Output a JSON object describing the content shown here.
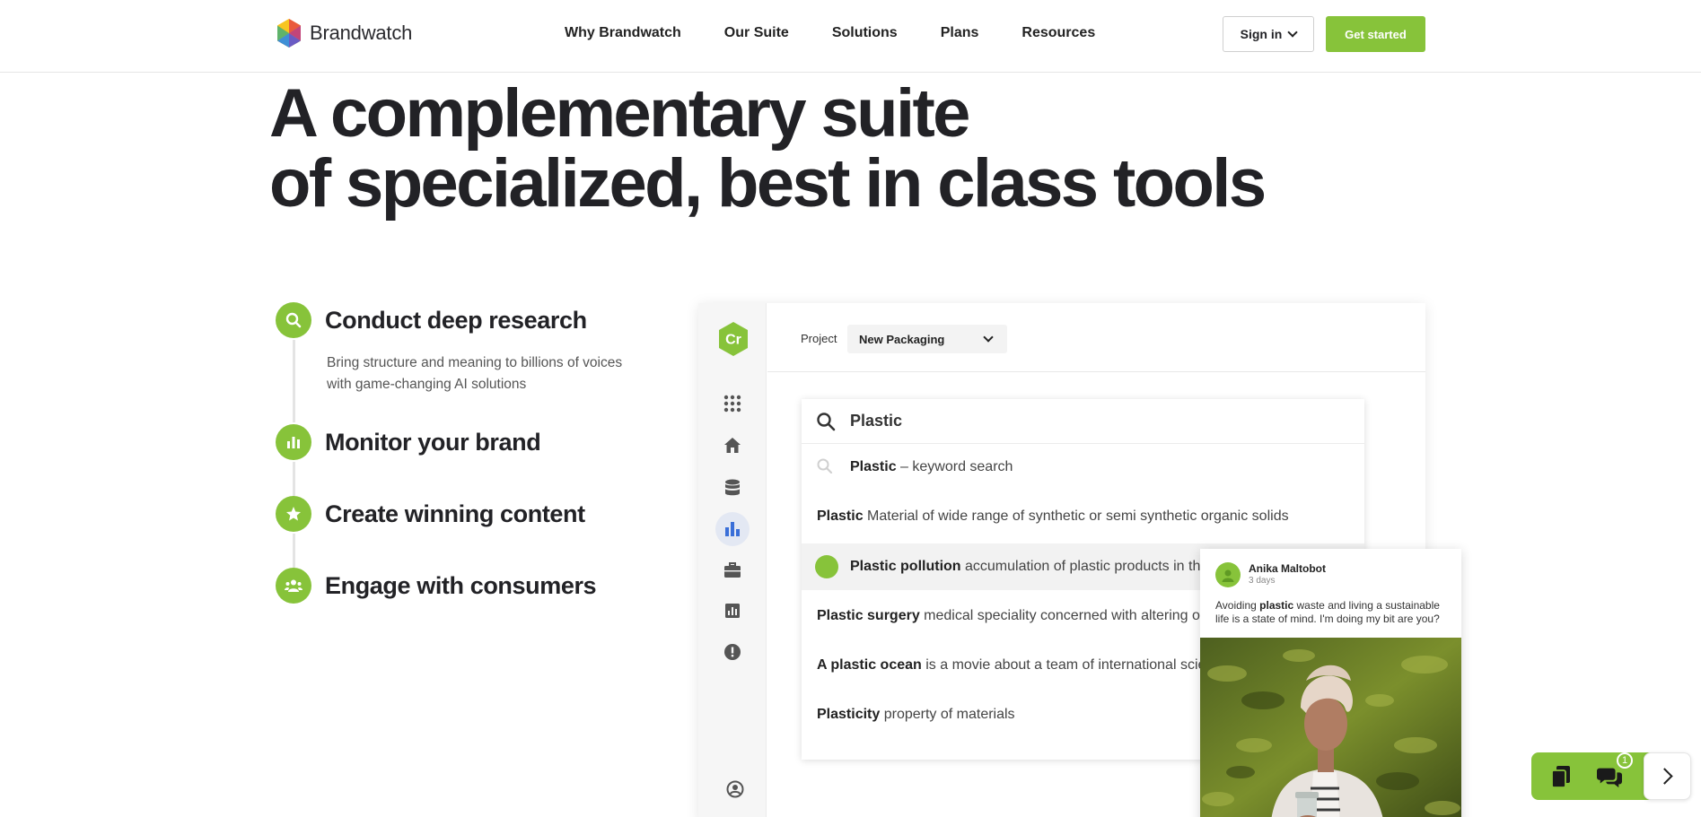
{
  "header": {
    "brand": "Brandwatch",
    "nav": [
      {
        "label": "Why Brandwatch"
      },
      {
        "label": "Our Suite"
      },
      {
        "label": "Solutions"
      },
      {
        "label": "Plans"
      },
      {
        "label": "Resources"
      }
    ],
    "sign_in": "Sign in",
    "get_started": "Get started"
  },
  "hero": {
    "line1": "A complementary suite",
    "line2": "of specialized, best in class tools"
  },
  "features": [
    {
      "title": "Conduct deep research",
      "desc": "Bring structure and meaning to billions of voices with game-changing AI solutions",
      "icon": "search-icon"
    },
    {
      "title": "Monitor your brand",
      "icon": "bar-chart-icon"
    },
    {
      "title": "Create winning content",
      "icon": "star-icon"
    },
    {
      "title": "Engage with consumers",
      "icon": "people-icon"
    }
  ],
  "app": {
    "logo_text": "Cr",
    "project_label": "Project",
    "project_value": "New Packaging",
    "search_value": "Plastic",
    "results": [
      {
        "bold": "Plastic",
        "rest": " – keyword search"
      },
      {
        "bold": "Plastic",
        "rest": " Material of wide range of synthetic or semi synthetic organic solids"
      },
      {
        "bold": "Plastic pollution",
        "rest": " accumulation of plastic products in the"
      },
      {
        "bold": "Plastic surgery",
        "rest": " medical speciality concerned with altering or"
      },
      {
        "bold": "A plastic ocean",
        "rest": " is a movie about a team of international scie"
      },
      {
        "bold": "Plasticity",
        "rest": " property of materials"
      }
    ]
  },
  "post": {
    "author": "Anika Maltobot",
    "time": "3 days",
    "text_pre": "Avoiding ",
    "text_bold": "plastic",
    "text_post": " waste and living a sustainable life is a state of mind. I'm doing my bit are you?"
  },
  "widget": {
    "badge": "1"
  },
  "colors": {
    "accent": "#87c33a",
    "text": "#222226"
  }
}
